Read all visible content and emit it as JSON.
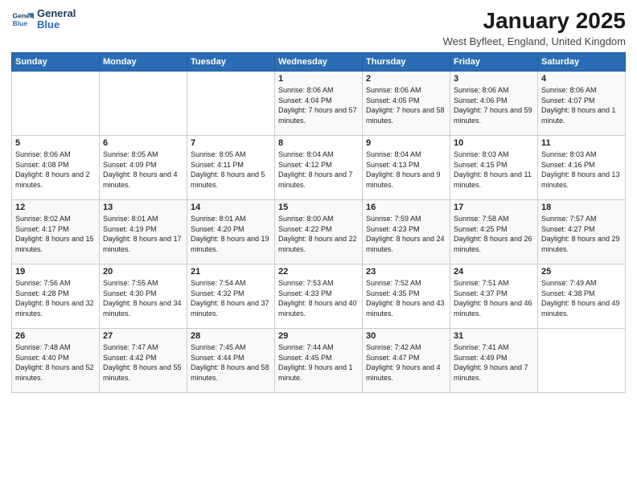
{
  "logo": {
    "line1": "General",
    "line2": "Blue"
  },
  "title": "January 2025",
  "location": "West Byfleet, England, United Kingdom",
  "days_of_week": [
    "Sunday",
    "Monday",
    "Tuesday",
    "Wednesday",
    "Thursday",
    "Friday",
    "Saturday"
  ],
  "weeks": [
    [
      {
        "day": "",
        "text": ""
      },
      {
        "day": "",
        "text": ""
      },
      {
        "day": "",
        "text": ""
      },
      {
        "day": "1",
        "text": "Sunrise: 8:06 AM\nSunset: 4:04 PM\nDaylight: 7 hours and 57 minutes."
      },
      {
        "day": "2",
        "text": "Sunrise: 8:06 AM\nSunset: 4:05 PM\nDaylight: 7 hours and 58 minutes."
      },
      {
        "day": "3",
        "text": "Sunrise: 8:06 AM\nSunset: 4:06 PM\nDaylight: 7 hours and 59 minutes."
      },
      {
        "day": "4",
        "text": "Sunrise: 8:06 AM\nSunset: 4:07 PM\nDaylight: 8 hours and 1 minute."
      }
    ],
    [
      {
        "day": "5",
        "text": "Sunrise: 8:06 AM\nSunset: 4:08 PM\nDaylight: 8 hours and 2 minutes."
      },
      {
        "day": "6",
        "text": "Sunrise: 8:05 AM\nSunset: 4:09 PM\nDaylight: 8 hours and 4 minutes."
      },
      {
        "day": "7",
        "text": "Sunrise: 8:05 AM\nSunset: 4:11 PM\nDaylight: 8 hours and 5 minutes."
      },
      {
        "day": "8",
        "text": "Sunrise: 8:04 AM\nSunset: 4:12 PM\nDaylight: 8 hours and 7 minutes."
      },
      {
        "day": "9",
        "text": "Sunrise: 8:04 AM\nSunset: 4:13 PM\nDaylight: 8 hours and 9 minutes."
      },
      {
        "day": "10",
        "text": "Sunrise: 8:03 AM\nSunset: 4:15 PM\nDaylight: 8 hours and 11 minutes."
      },
      {
        "day": "11",
        "text": "Sunrise: 8:03 AM\nSunset: 4:16 PM\nDaylight: 8 hours and 13 minutes."
      }
    ],
    [
      {
        "day": "12",
        "text": "Sunrise: 8:02 AM\nSunset: 4:17 PM\nDaylight: 8 hours and 15 minutes."
      },
      {
        "day": "13",
        "text": "Sunrise: 8:01 AM\nSunset: 4:19 PM\nDaylight: 8 hours and 17 minutes."
      },
      {
        "day": "14",
        "text": "Sunrise: 8:01 AM\nSunset: 4:20 PM\nDaylight: 8 hours and 19 minutes."
      },
      {
        "day": "15",
        "text": "Sunrise: 8:00 AM\nSunset: 4:22 PM\nDaylight: 8 hours and 22 minutes."
      },
      {
        "day": "16",
        "text": "Sunrise: 7:59 AM\nSunset: 4:23 PM\nDaylight: 8 hours and 24 minutes."
      },
      {
        "day": "17",
        "text": "Sunrise: 7:58 AM\nSunset: 4:25 PM\nDaylight: 8 hours and 26 minutes."
      },
      {
        "day": "18",
        "text": "Sunrise: 7:57 AM\nSunset: 4:27 PM\nDaylight: 8 hours and 29 minutes."
      }
    ],
    [
      {
        "day": "19",
        "text": "Sunrise: 7:56 AM\nSunset: 4:28 PM\nDaylight: 8 hours and 32 minutes."
      },
      {
        "day": "20",
        "text": "Sunrise: 7:55 AM\nSunset: 4:30 PM\nDaylight: 8 hours and 34 minutes."
      },
      {
        "day": "21",
        "text": "Sunrise: 7:54 AM\nSunset: 4:32 PM\nDaylight: 8 hours and 37 minutes."
      },
      {
        "day": "22",
        "text": "Sunrise: 7:53 AM\nSunset: 4:33 PM\nDaylight: 8 hours and 40 minutes."
      },
      {
        "day": "23",
        "text": "Sunrise: 7:52 AM\nSunset: 4:35 PM\nDaylight: 8 hours and 43 minutes."
      },
      {
        "day": "24",
        "text": "Sunrise: 7:51 AM\nSunset: 4:37 PM\nDaylight: 8 hours and 46 minutes."
      },
      {
        "day": "25",
        "text": "Sunrise: 7:49 AM\nSunset: 4:38 PM\nDaylight: 8 hours and 49 minutes."
      }
    ],
    [
      {
        "day": "26",
        "text": "Sunrise: 7:48 AM\nSunset: 4:40 PM\nDaylight: 8 hours and 52 minutes."
      },
      {
        "day": "27",
        "text": "Sunrise: 7:47 AM\nSunset: 4:42 PM\nDaylight: 8 hours and 55 minutes."
      },
      {
        "day": "28",
        "text": "Sunrise: 7:45 AM\nSunset: 4:44 PM\nDaylight: 8 hours and 58 minutes."
      },
      {
        "day": "29",
        "text": "Sunrise: 7:44 AM\nSunset: 4:45 PM\nDaylight: 9 hours and 1 minute."
      },
      {
        "day": "30",
        "text": "Sunrise: 7:42 AM\nSunset: 4:47 PM\nDaylight: 9 hours and 4 minutes."
      },
      {
        "day": "31",
        "text": "Sunrise: 7:41 AM\nSunset: 4:49 PM\nDaylight: 9 hours and 7 minutes."
      },
      {
        "day": "",
        "text": ""
      }
    ]
  ]
}
